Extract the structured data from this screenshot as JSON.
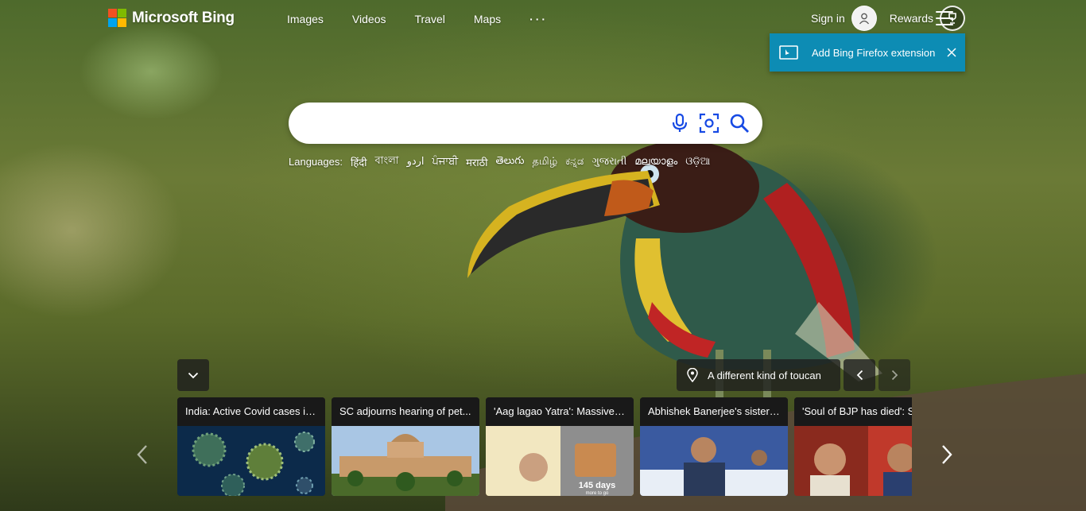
{
  "brand": {
    "name": "Microsoft Bing",
    "logo_colors": [
      "#f25022",
      "#7fba00",
      "#00a4ef",
      "#ffb900"
    ]
  },
  "nav": {
    "items": [
      {
        "label": "Images"
      },
      {
        "label": "Videos"
      },
      {
        "label": "Travel"
      },
      {
        "label": "Maps"
      },
      {
        "label": "···"
      }
    ]
  },
  "account": {
    "signin_label": "Sign in",
    "avatar_icon": "person-icon",
    "rewards_label": "Rewards",
    "rewards_icon": "trophy-icon",
    "menu_icon": "hamburger-menu-icon"
  },
  "extension_banner": {
    "text": "Add Bing Firefox extension",
    "color": "#0d8cb4"
  },
  "search": {
    "value": "",
    "placeholder": "",
    "icons": [
      "microphone-icon",
      "visual-search-icon",
      "search-icon"
    ],
    "icon_color": "#174ae4"
  },
  "languages": {
    "label": "Languages:",
    "items": [
      "हिंदी",
      "বাংলা",
      "اردو",
      "ਪੰਜਾਬੀ",
      "मराठी",
      "తెలుగు",
      "தமிழ்",
      "ಕನ್ನಡ",
      "ગુજરાતી",
      "മലയാളം",
      "ଓଡ଼ିଆ"
    ]
  },
  "image_info": {
    "caption": "A different kind of toucan",
    "location_icon": "location-pin-icon"
  },
  "news": {
    "cards": [
      {
        "title": "India: Active Covid cases in..."
      },
      {
        "title": "SC adjourns hearing of pet..."
      },
      {
        "title": "'Aag lagao Yatra': Massive ..."
      },
      {
        "title": "Abhishek Banerjee's sister-..."
      },
      {
        "title": "'Soul of BJP has died': Shiv Sena"
      }
    ],
    "card3_overlay": "145 days",
    "card3_overlay_sub": "more to go"
  }
}
